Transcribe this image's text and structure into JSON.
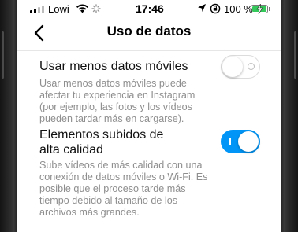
{
  "status_bar": {
    "carrier": "Lowi",
    "time": "17:46",
    "battery_percent": "100 %",
    "battery_level": 1.0,
    "icons": [
      "signal-icon",
      "wifi-icon",
      "loading-icon",
      "location-icon",
      "rotation-lock-icon",
      "battery-charging-icon"
    ]
  },
  "nav": {
    "back_icon": "chevron-left-icon",
    "title": "Uso de datos"
  },
  "settings": [
    {
      "title": "Usar menos datos móviles",
      "description_lines": [
        "Usar menos datos móviles puede",
        "afectar tu experiencia en Instagram",
        "(por ejemplo, las fotos y los vídeos",
        "pueden tardar más en cargarse)."
      ],
      "enabled": false
    },
    {
      "title_lines": [
        "Elementos subidos de",
        "alta calidad"
      ],
      "description_lines": [
        "Sube vídeos de más calidad con una",
        "conexión de datos móviles o Wi-Fi. Es",
        "posible que el proceso tarde más",
        "tiempo debido al tamaño de los",
        "archivos más grandes."
      ],
      "enabled": true
    }
  ],
  "colors": {
    "toggle_on": "#0095f6",
    "toggle_off_border": "#dcdcdc",
    "description_text": "#8e8e8e",
    "battery_fill": "#34c759"
  }
}
